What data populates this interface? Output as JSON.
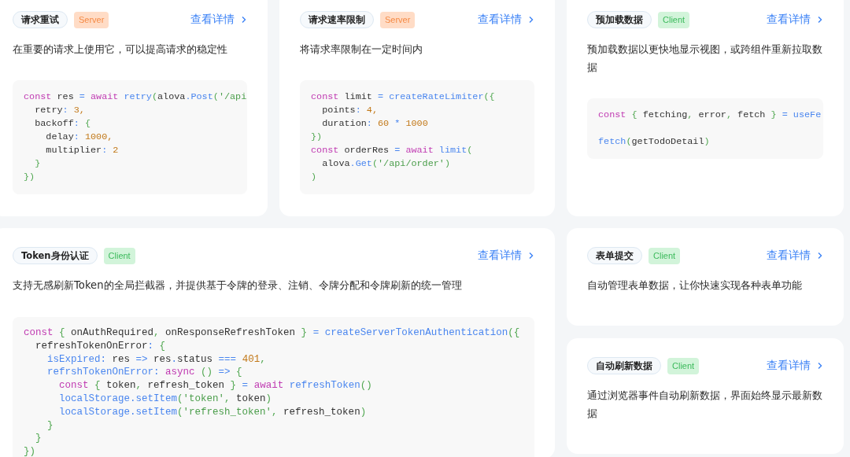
{
  "cards": [
    {
      "title": "请求重试",
      "badge": {
        "text": "Server",
        "kind": "server"
      },
      "link": "查看详情",
      "description": "在重要的请求上使用它，可以提高请求的稳定性",
      "wide": false,
      "code": [
        {
          "kind": "code",
          "tokens": [
            {
              "kind": "kw",
              "t": "const"
            },
            {
              "kind": "id",
              "t": " res"
            },
            {
              "kind": "fn",
              "t": " = "
            },
            {
              "kind": "kw",
              "t": "await"
            },
            {
              "kind": "fn",
              "t": " retry"
            },
            {
              "kind": "pu",
              "t": "("
            },
            {
              "kind": "id",
              "t": "alova"
            },
            {
              "kind": "fn",
              "t": ".Post"
            },
            {
              "kind": "pu",
              "t": "("
            },
            {
              "kind": "str",
              "t": "'/api"
            }
          ]
        },
        {
          "kind": "code",
          "tokens": [
            {
              "kind": "id",
              "t": "  retry"
            },
            {
              "kind": "fn",
              "t": ": "
            },
            {
              "kind": "num",
              "t": "3,"
            }
          ]
        },
        {
          "kind": "code",
          "tokens": [
            {
              "kind": "id",
              "t": "  backoff"
            },
            {
              "kind": "fn",
              "t": ": "
            },
            {
              "kind": "pu",
              "t": "{"
            }
          ]
        },
        {
          "kind": "code",
          "tokens": [
            {
              "kind": "id",
              "t": "    delay"
            },
            {
              "kind": "fn",
              "t": ": "
            },
            {
              "kind": "num",
              "t": "1000,"
            }
          ]
        },
        {
          "kind": "code",
          "tokens": [
            {
              "kind": "id",
              "t": "    multiplier"
            },
            {
              "kind": "fn",
              "t": ": "
            },
            {
              "kind": "num",
              "t": "2"
            }
          ]
        },
        {
          "kind": "code",
          "tokens": [
            {
              "kind": "pu",
              "t": "  }"
            }
          ]
        },
        {
          "kind": "code",
          "tokens": [
            {
              "kind": "pu",
              "t": "})"
            }
          ]
        }
      ]
    },
    {
      "title": "请求速率限制",
      "badge": {
        "text": "Server",
        "kind": "server"
      },
      "link": "查看详情",
      "description": "将请求率限制在一定时间内",
      "wide": false,
      "code": [
        {
          "kind": "code",
          "tokens": [
            {
              "kind": "kw",
              "t": "const"
            },
            {
              "kind": "id",
              "t": " limit"
            },
            {
              "kind": "fn",
              "t": " = createRateLimiter"
            },
            {
              "kind": "pu",
              "t": "({"
            }
          ]
        },
        {
          "kind": "code",
          "tokens": [
            {
              "kind": "id",
              "t": "  points"
            },
            {
              "kind": "fn",
              "t": ": "
            },
            {
              "kind": "num",
              "t": "4,"
            }
          ]
        },
        {
          "kind": "code",
          "tokens": [
            {
              "kind": "id",
              "t": "  duration"
            },
            {
              "kind": "fn",
              "t": ": "
            },
            {
              "kind": "num",
              "t": "60"
            },
            {
              "kind": "fn",
              "t": " * "
            },
            {
              "kind": "num",
              "t": "1000"
            }
          ]
        },
        {
          "kind": "code",
          "tokens": [
            {
              "kind": "pu",
              "t": "})"
            }
          ]
        },
        {
          "kind": "code",
          "tokens": [
            {
              "kind": "kw",
              "t": "const"
            },
            {
              "kind": "id",
              "t": " orderRes"
            },
            {
              "kind": "fn",
              "t": " = "
            },
            {
              "kind": "kw",
              "t": "await"
            },
            {
              "kind": "fn",
              "t": " limit"
            },
            {
              "kind": "pu",
              "t": "("
            }
          ]
        },
        {
          "kind": "code",
          "tokens": [
            {
              "kind": "id",
              "t": "  alova"
            },
            {
              "kind": "fn",
              "t": ".Get"
            },
            {
              "kind": "pu",
              "t": "("
            },
            {
              "kind": "str",
              "t": "'/api/order'"
            },
            {
              "kind": "pu",
              "t": ")"
            }
          ]
        },
        {
          "kind": "code",
          "tokens": [
            {
              "kind": "pu",
              "t": ")"
            }
          ]
        }
      ]
    },
    {
      "title": "预加载数据",
      "badge": {
        "text": "Client",
        "kind": "client"
      },
      "link": "查看详情",
      "description": "预加载数据以更快地显示视图，或跨组件重新拉取数据",
      "wide": false,
      "code": [
        {
          "kind": "code",
          "tokens": [
            {
              "kind": "kw",
              "t": "const"
            },
            {
              "kind": "pu",
              "t": " {"
            },
            {
              "kind": "id",
              "t": " fetching"
            },
            {
              "kind": "pu",
              "t": ","
            },
            {
              "kind": "id",
              "t": " error"
            },
            {
              "kind": "pu",
              "t": ","
            },
            {
              "kind": "id",
              "t": " fetch"
            },
            {
              "kind": "pu",
              "t": " }"
            },
            {
              "kind": "fn",
              "t": " = useFe"
            }
          ]
        },
        {
          "kind": "blank"
        },
        {
          "kind": "code",
          "tokens": [
            {
              "kind": "fn",
              "t": "fetch"
            },
            {
              "kind": "pu",
              "t": "("
            },
            {
              "kind": "id",
              "t": "getTodoDetail"
            },
            {
              "kind": "pu",
              "t": ")"
            }
          ]
        }
      ]
    },
    {
      "title": "Token身份认证",
      "badge": {
        "text": "Client",
        "kind": "client"
      },
      "link": "查看详情",
      "description": "支持无感刷新Token的全局拦截器，并提供基于令牌的登录、注销、令牌分配和令牌刷新的统一管理",
      "wide": true,
      "code": [
        {
          "kind": "code",
          "tokens": [
            {
              "kind": "kw",
              "t": "const"
            },
            {
              "kind": "pu",
              "t": " {"
            },
            {
              "kind": "id",
              "t": " onAuthRequired"
            },
            {
              "kind": "pu",
              "t": ","
            },
            {
              "kind": "id",
              "t": " onResponseRefreshToken"
            },
            {
              "kind": "pu",
              "t": " }"
            },
            {
              "kind": "fn",
              "t": " = createServerTokenAuthentication"
            },
            {
              "kind": "pu",
              "t": "({"
            }
          ]
        },
        {
          "kind": "code",
          "tokens": [
            {
              "kind": "id",
              "t": "  refreshTokenOnError"
            },
            {
              "kind": "fn",
              "t": ": "
            },
            {
              "kind": "pu",
              "t": "{"
            }
          ]
        },
        {
          "kind": "code",
          "tokens": [
            {
              "kind": "fn",
              "t": "    isExpired: "
            },
            {
              "kind": "id",
              "t": "res "
            },
            {
              "kind": "fn",
              "t": "=> "
            },
            {
              "kind": "id",
              "t": "res"
            },
            {
              "kind": "fn",
              "t": "."
            },
            {
              "kind": "id",
              "t": "status "
            },
            {
              "kind": "fn",
              "t": "=== "
            },
            {
              "kind": "num",
              "t": "401"
            },
            {
              "kind": "pu",
              "t": ","
            }
          ]
        },
        {
          "kind": "code",
          "tokens": [
            {
              "kind": "fn",
              "t": "    refrshTokenOnError: "
            },
            {
              "kind": "kw",
              "t": "async"
            },
            {
              "kind": "pu",
              "t": " () "
            },
            {
              "kind": "fn",
              "t": "=>"
            },
            {
              "kind": "pu",
              "t": " {"
            }
          ]
        },
        {
          "kind": "code",
          "tokens": [
            {
              "kind": "kw",
              "t": "      const"
            },
            {
              "kind": "pu",
              "t": " {"
            },
            {
              "kind": "id",
              "t": " token"
            },
            {
              "kind": "pu",
              "t": ","
            },
            {
              "kind": "id",
              "t": " refresh_token"
            },
            {
              "kind": "pu",
              "t": " }"
            },
            {
              "kind": "fn",
              "t": " = "
            },
            {
              "kind": "kw",
              "t": "await"
            },
            {
              "kind": "fn",
              "t": " refreshToken"
            },
            {
              "kind": "pu",
              "t": "()"
            }
          ]
        },
        {
          "kind": "code",
          "tokens": [
            {
              "kind": "fn",
              "t": "      localStorage.setItem"
            },
            {
              "kind": "pu",
              "t": "("
            },
            {
              "kind": "str",
              "t": "'token'"
            },
            {
              "kind": "pu",
              "t": ","
            },
            {
              "kind": "id",
              "t": " token"
            },
            {
              "kind": "pu",
              "t": ")"
            }
          ]
        },
        {
          "kind": "code",
          "tokens": [
            {
              "kind": "fn",
              "t": "      localStorage.setItem"
            },
            {
              "kind": "pu",
              "t": "("
            },
            {
              "kind": "str",
              "t": "'refresh_token'"
            },
            {
              "kind": "pu",
              "t": ","
            },
            {
              "kind": "id",
              "t": " refresh_token"
            },
            {
              "kind": "pu",
              "t": ")"
            }
          ]
        },
        {
          "kind": "code",
          "tokens": [
            {
              "kind": "pu",
              "t": "    }"
            }
          ]
        },
        {
          "kind": "code",
          "tokens": [
            {
              "kind": "pu",
              "t": "  }"
            }
          ]
        },
        {
          "kind": "code",
          "tokens": [
            {
              "kind": "pu",
              "t": "})"
            }
          ]
        }
      ]
    }
  ],
  "side_cards": [
    {
      "title": "表单提交",
      "badge": {
        "text": "Client",
        "kind": "client"
      },
      "link": "查看详情",
      "description": "自动管理表单数据，让你快速实现各种表单功能"
    },
    {
      "title": "自动刷新数据",
      "badge": {
        "text": "Client",
        "kind": "client"
      },
      "link": "查看详情",
      "description": "通过浏览器事件自动刷新数据，界面始终显示最新数据"
    }
  ]
}
